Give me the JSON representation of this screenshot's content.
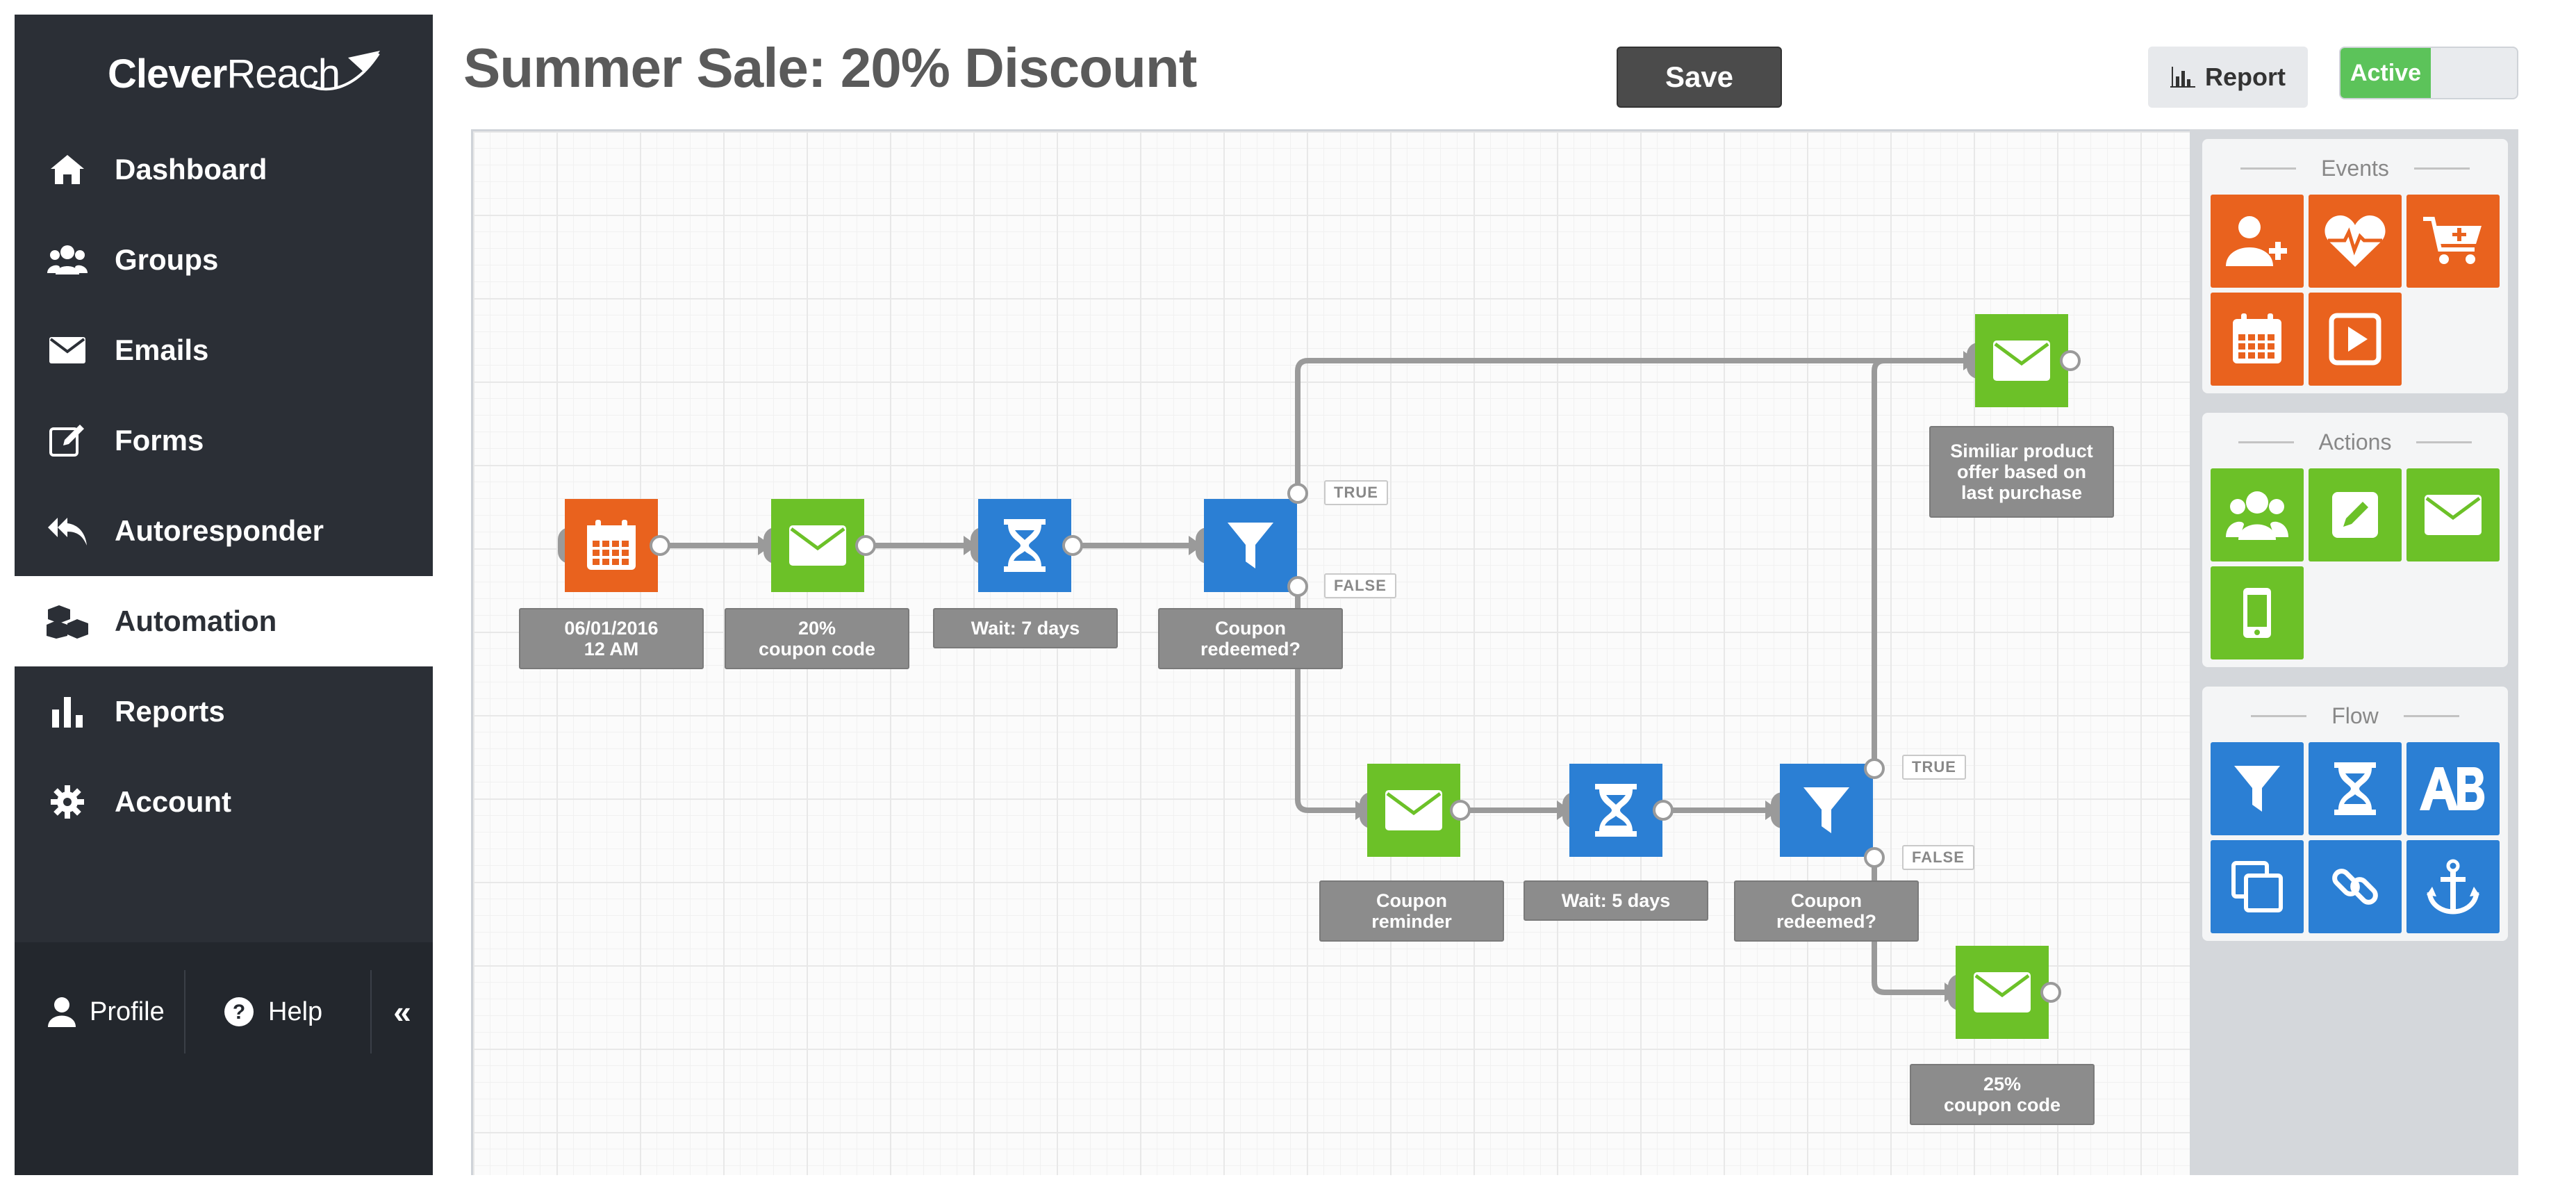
{
  "brand": {
    "name_bold": "Clever",
    "name_reg": "Reach"
  },
  "sidebar": {
    "items": [
      {
        "label": "Dashboard",
        "icon": "home-icon"
      },
      {
        "label": "Groups",
        "icon": "users-icon"
      },
      {
        "label": "Emails",
        "icon": "envelope-icon"
      },
      {
        "label": "Forms",
        "icon": "edit-icon"
      },
      {
        "label": "Autoresponder",
        "icon": "reply-all-icon"
      },
      {
        "label": "Automation",
        "icon": "cubes-icon",
        "active": true
      },
      {
        "label": "Reports",
        "icon": "bar-chart-icon"
      },
      {
        "label": "Account",
        "icon": "gear-icon"
      }
    ],
    "profile": "Profile",
    "help": "Help",
    "collapse": "«"
  },
  "header": {
    "title": "Summer Sale: 20% Discount",
    "save": "Save",
    "report": "Report",
    "status": "Active"
  },
  "flow": {
    "nodes": [
      {
        "label": "06/01/2016\n12 AM"
      },
      {
        "label": "20%\ncoupon code"
      },
      {
        "label": "Wait: 7 days"
      },
      {
        "label": "Coupon\nredeemed?"
      },
      {
        "label": "Similiar product\noffer based on\nlast purchase"
      },
      {
        "label": "Coupon\nreminder"
      },
      {
        "label": "Wait: 5 days"
      },
      {
        "label": "Coupon\nredeemed?"
      },
      {
        "label": "25%\ncoupon code"
      }
    ],
    "true_label": "TRUE",
    "false_label": "FALSE"
  },
  "palette": {
    "events": "Events",
    "actions": "Actions",
    "flow": "Flow"
  },
  "colors": {
    "orange": "#e9621e",
    "green": "#6cc128",
    "blue": "#2b7fd4",
    "sidebar": "#2b2f36"
  }
}
